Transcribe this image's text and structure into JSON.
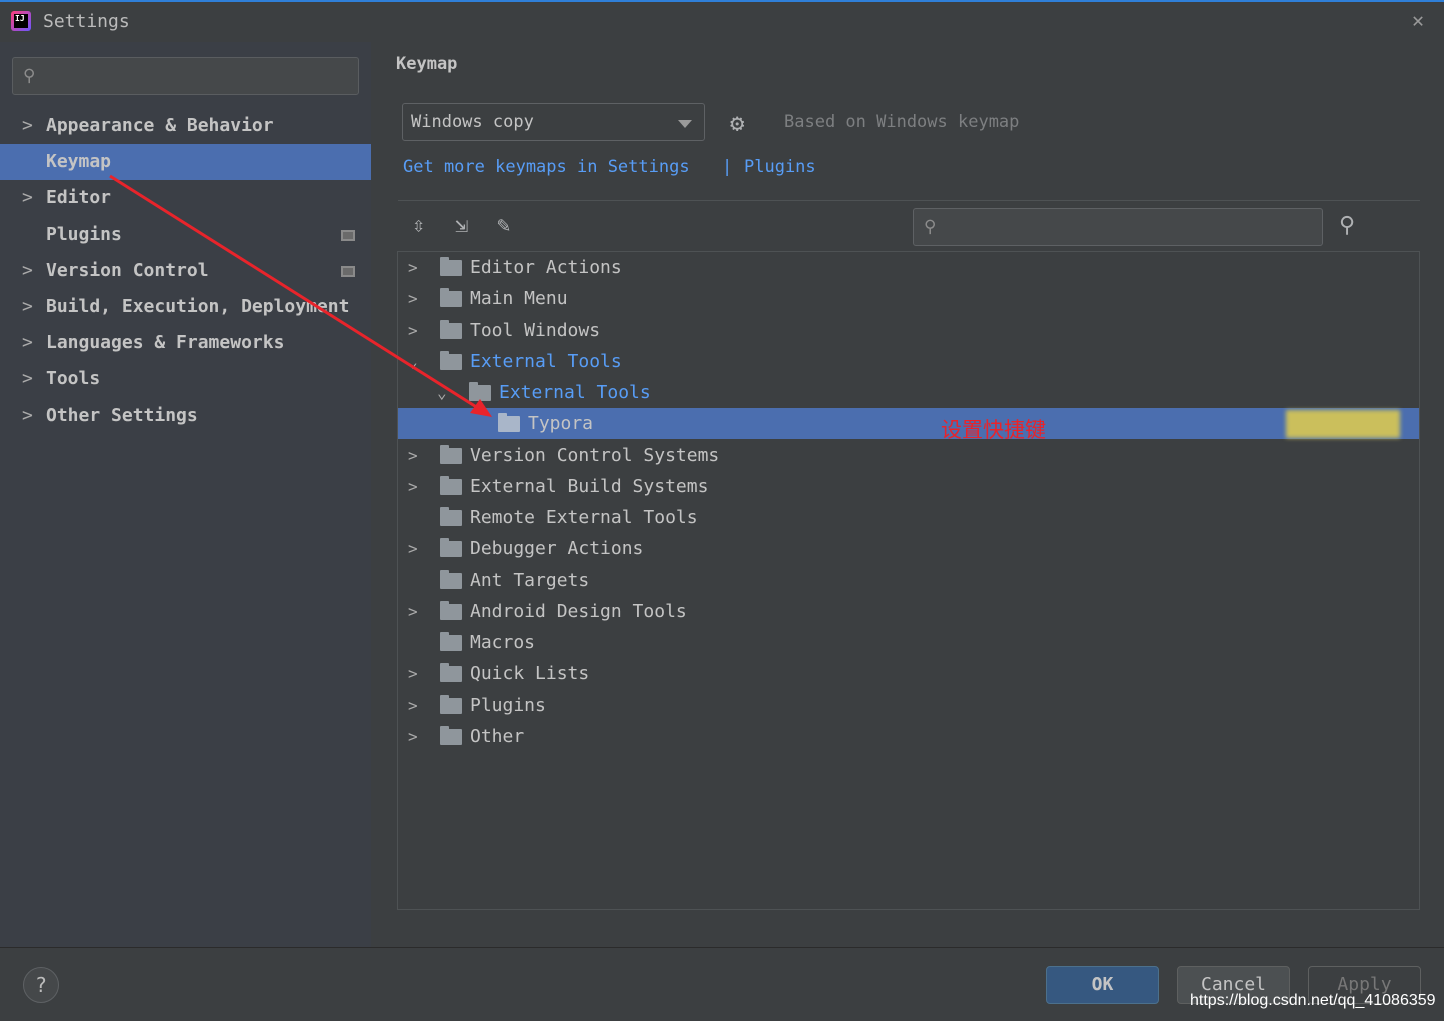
{
  "window": {
    "title": "Settings",
    "close": "✕"
  },
  "sidebar": {
    "search_placeholder": "",
    "items": [
      {
        "label": "Appearance & Behavior",
        "expandable": true
      },
      {
        "label": "Keymap",
        "selected": true
      },
      {
        "label": "Editor",
        "expandable": true
      },
      {
        "label": "Plugins",
        "badge": true
      },
      {
        "label": "Version Control",
        "expandable": true,
        "badge": true
      },
      {
        "label": "Build, Execution, Deployment",
        "expandable": true
      },
      {
        "label": "Languages & Frameworks",
        "expandable": true
      },
      {
        "label": "Tools",
        "expandable": true
      },
      {
        "label": "Other Settings",
        "expandable": true
      }
    ]
  },
  "main": {
    "title": "Keymap",
    "keymap_value": "Windows copy",
    "based_on": "Based on Windows keymap",
    "link_settings": "Get more keymaps in Settings",
    "link_sep": "|",
    "link_plugins": "Plugins",
    "tree": [
      {
        "label": "Editor Actions",
        "chev": ">"
      },
      {
        "label": "Main Menu",
        "chev": ">"
      },
      {
        "label": "Tool Windows",
        "chev": ">"
      },
      {
        "label": "External Tools",
        "chev": "v",
        "blue": true
      },
      {
        "label": "External Tools",
        "chev": "v",
        "blue": true,
        "indent": 1
      },
      {
        "label": "Typora",
        "indent": 2,
        "selected": true
      },
      {
        "label": "Version Control Systems",
        "chev": ">"
      },
      {
        "label": "External Build Systems",
        "chev": ">"
      },
      {
        "label": "Remote External Tools"
      },
      {
        "label": "Debugger Actions",
        "chev": ">"
      },
      {
        "label": "Ant Targets"
      },
      {
        "label": "Android Design Tools",
        "chev": ">"
      },
      {
        "label": "Macros"
      },
      {
        "label": "Quick Lists",
        "chev": ">"
      },
      {
        "label": "Plugins",
        "chev": ">"
      },
      {
        "label": "Other",
        "chev": ">"
      }
    ],
    "annotation": "设置快捷键"
  },
  "footer": {
    "help": "?",
    "ok": "OK",
    "cancel": "Cancel",
    "apply": "Apply"
  },
  "watermark": "https://blog.csdn.net/qq_41086359",
  "colors": {
    "selection": "#4b6eaf",
    "link": "#589df6",
    "annotation": "#e8242b"
  }
}
